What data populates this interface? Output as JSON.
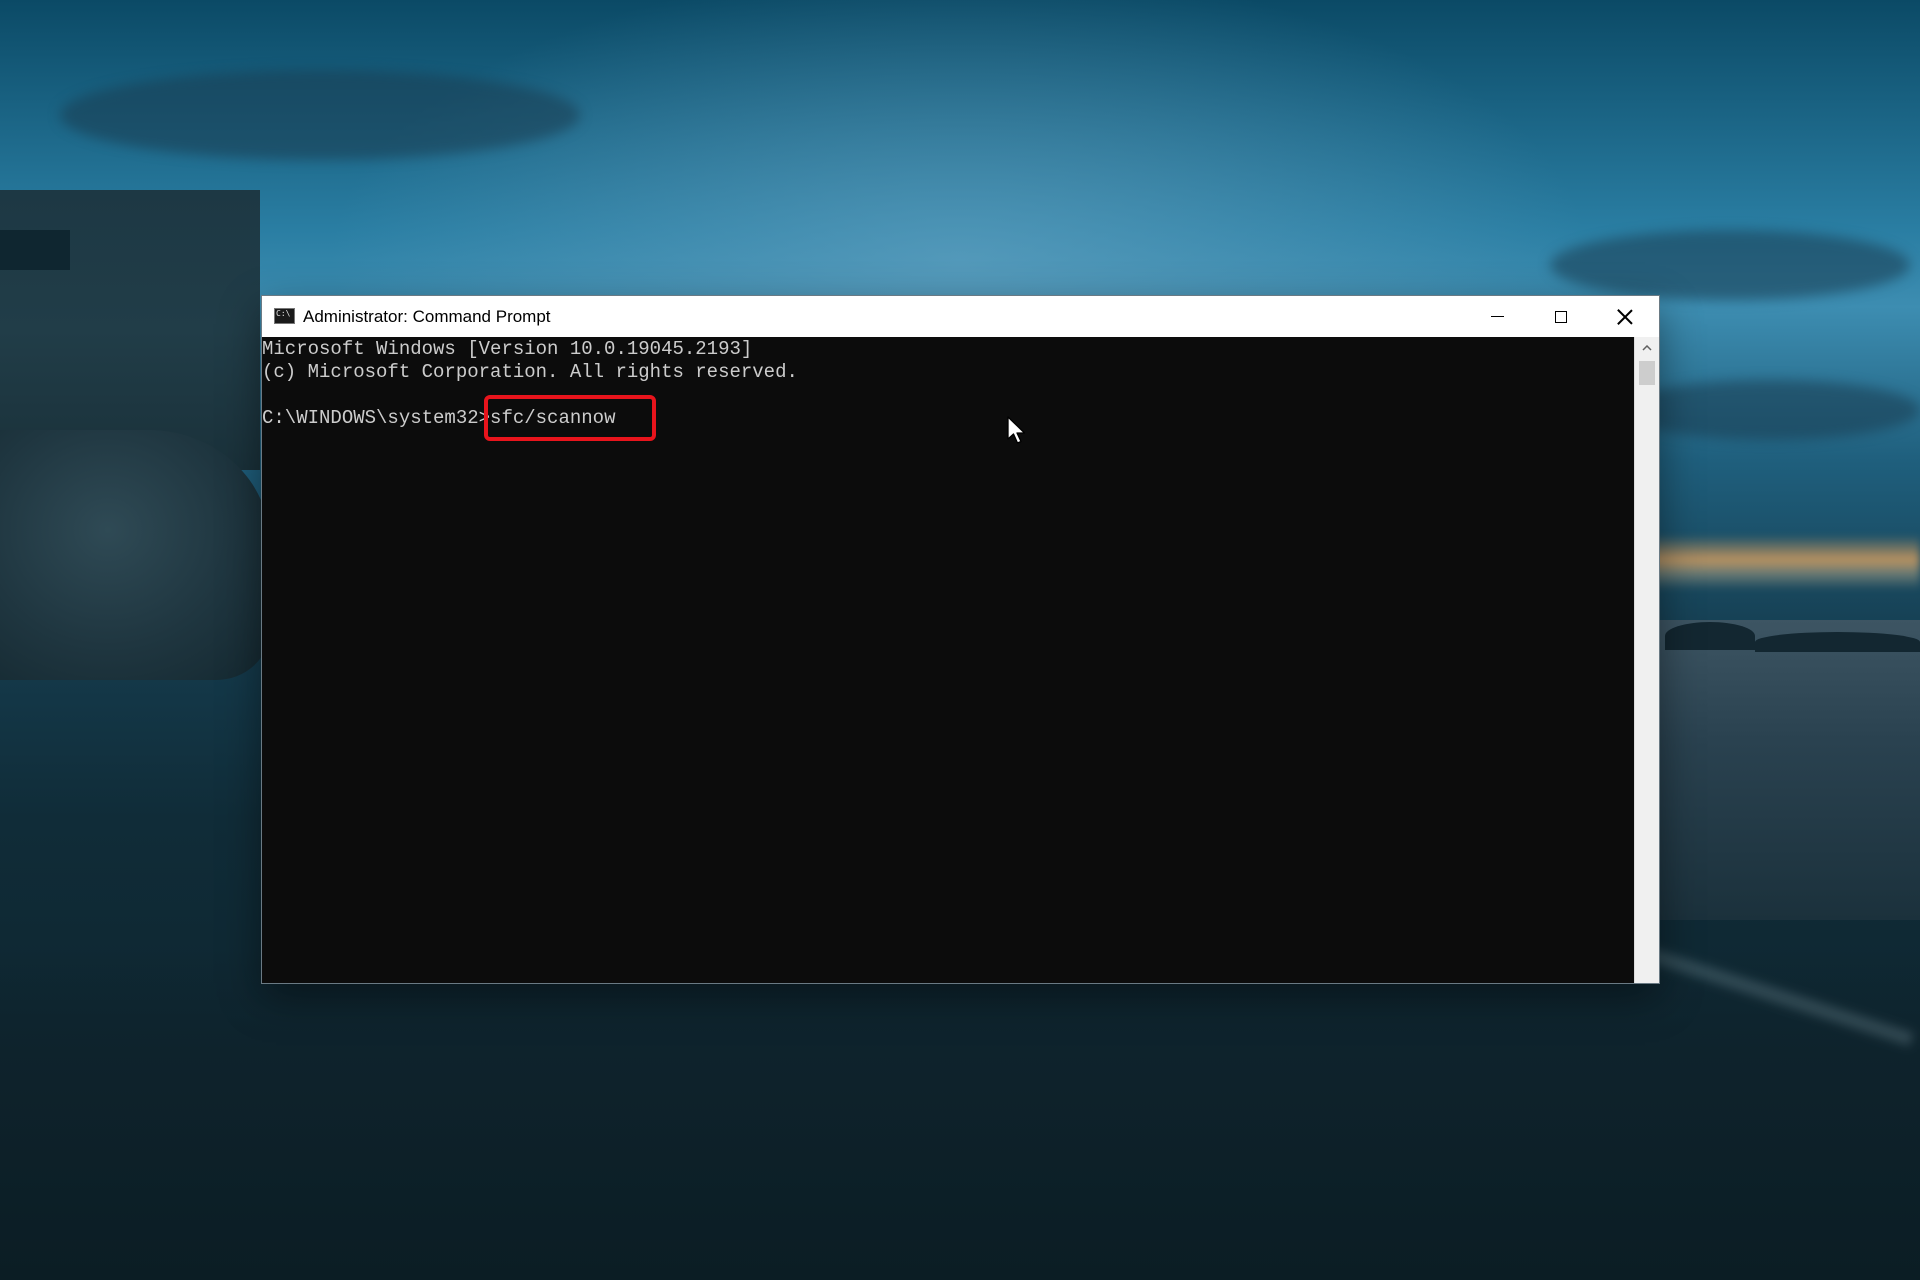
{
  "window": {
    "title": "Administrator: Command Prompt",
    "app_icon_text": "C:\\"
  },
  "console": {
    "line1": "Microsoft Windows [Version 10.0.19045.2193]",
    "line2": "(c) Microsoft Corporation. All rights reserved.",
    "prompt": "C:\\WINDOWS\\system32>",
    "command": "sfc/scannow"
  },
  "colors": {
    "console_bg": "#0c0c0c",
    "console_text": "#cccccc",
    "highlight": "#e8141c",
    "titlebar": "#ffffff"
  },
  "icons": {
    "app": "command-prompt-icon",
    "minimize": "minimize-icon",
    "maximize": "maximize-icon",
    "close": "close-icon",
    "scroll_up": "chevron-up-icon",
    "cursor": "mouse-pointer-icon"
  }
}
